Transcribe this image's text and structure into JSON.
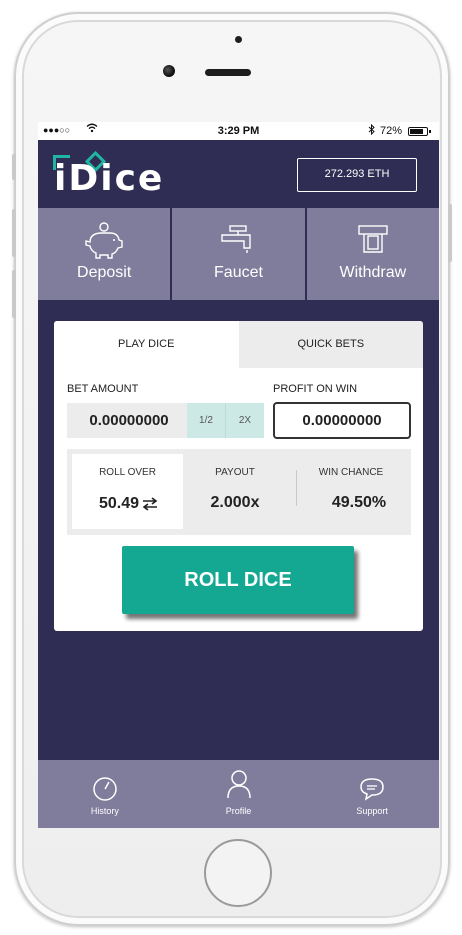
{
  "status_bar": {
    "signal": "●●●○○",
    "time": "3:29 PM",
    "battery": "72%"
  },
  "header": {
    "logo": "iDice",
    "balance": "272.293 ETH"
  },
  "actions": [
    {
      "label": "Deposit",
      "icon": "piggy-bank-icon"
    },
    {
      "label": "Faucet",
      "icon": "faucet-icon"
    },
    {
      "label": "Withdraw",
      "icon": "atm-icon"
    }
  ],
  "tabs": [
    {
      "label": "PLAY DICE",
      "active": true
    },
    {
      "label": "QUICK BETS",
      "active": false
    }
  ],
  "bet": {
    "amount_label": "BET AMOUNT",
    "amount_value": "0.00000000",
    "half_label": "1/2",
    "double_label": "2X",
    "profit_label": "PROFIT ON WIN",
    "profit_value": "0.00000000"
  },
  "stats": {
    "roll_over_label": "ROLL OVER",
    "roll_over_value": "50.49",
    "payout_label": "PAYOUT",
    "payout_value": "2.000x",
    "win_chance_label": "WIN CHANCE",
    "win_chance_value": "49.50%"
  },
  "roll_button": "ROLL DICE",
  "bottom_nav": [
    {
      "label": "History",
      "icon": "clock-icon"
    },
    {
      "label": "Profile",
      "icon": "user-icon"
    },
    {
      "label": "Support",
      "icon": "chat-bubble-icon"
    }
  ],
  "colors": {
    "background": "#302d54",
    "panel": "#807c9b",
    "accent": "#14a892",
    "multiplier_bg": "#cde9e6"
  }
}
